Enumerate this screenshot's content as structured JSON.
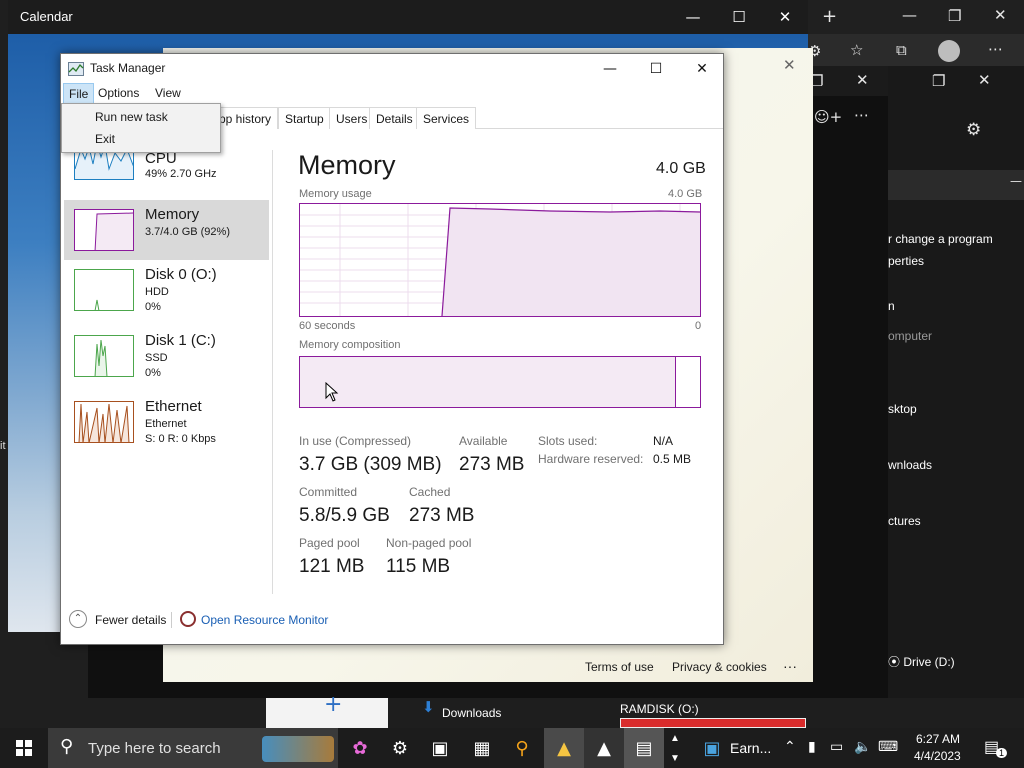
{
  "calendar": {
    "title": "Calendar"
  },
  "browser": {
    "footer_terms": "Terms of use",
    "footer_privacy": "Privacy & cookies",
    "footer_more": "···"
  },
  "explorer": {
    "items": [
      "r change a program",
      "perties",
      "n",
      "omputer",
      "sktop",
      "wnloads",
      "ctures",
      "⦿ Drive (D:)"
    ]
  },
  "left_edge": {
    "char": "it"
  },
  "task_manager": {
    "title": "Task Manager",
    "menu": [
      "File",
      "Options",
      "View"
    ],
    "file_menu": [
      "Run new task",
      "Exit"
    ],
    "tabs": [
      "pp history",
      "Startup",
      "Users",
      "Details",
      "Services"
    ],
    "sidebar": [
      {
        "name": "CPU",
        "line2": "49%  2.70 GHz",
        "line3": ""
      },
      {
        "name": "Memory",
        "line2": "3.7/4.0 GB (92%)",
        "line3": ""
      },
      {
        "name": "Disk 0 (O:)",
        "line2": "HDD",
        "line3": "0%"
      },
      {
        "name": "Disk 1 (C:)",
        "line2": "SSD",
        "line3": "0%"
      },
      {
        "name": "Ethernet",
        "line2": "Ethernet",
        "line3": "S: 0  R: 0 Kbps"
      }
    ],
    "memory": {
      "heading": "Memory",
      "total": "4.0 GB",
      "usage_label": "Memory usage",
      "usage_max": "4.0 GB",
      "x_left": "60 seconds",
      "x_right": "0",
      "composition_label": "Memory composition",
      "in_use_label": "In use (Compressed)",
      "in_use_value": "3.7 GB (309 MB)",
      "available_label": "Available",
      "available_value": "273 MB",
      "slots_label": "Slots used:",
      "slots_value": "N/A",
      "hw_label": "Hardware reserved:",
      "hw_value": "0.5 MB",
      "committed_label": "Committed",
      "committed_value": "5.8/5.9 GB",
      "cached_label": "Cached",
      "cached_value": "273 MB",
      "paged_label": "Paged pool",
      "paged_value": "121 MB",
      "nonpaged_label": "Non-paged pool",
      "nonpaged_value": "115 MB"
    },
    "fewer_details": "Fewer details",
    "open_resource_monitor": "Open Resource Monitor"
  },
  "downloads_strip": {
    "downloads": "Downloads",
    "ramdisk": "RAMDISK (O:)"
  },
  "taskbar": {
    "search_placeholder": "Type here to search",
    "earn_label": "Earn...",
    "time": "6:27 AM",
    "date": "4/4/2023",
    "notification_count": "1"
  },
  "colors": {
    "accent_purple": "#8b1a9c",
    "link_blue": "#1a5fb4",
    "taskbar": "#1c1c1c"
  }
}
